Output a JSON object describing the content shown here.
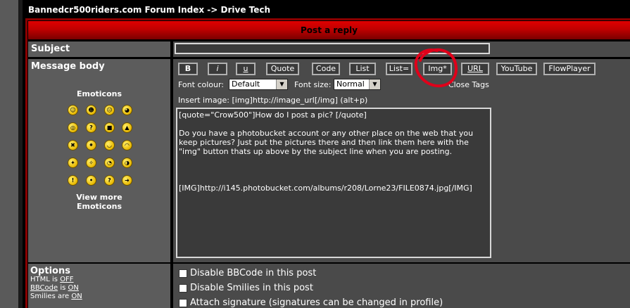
{
  "breadcrumb": "Bannedcr500riders.com Forum Index -> Drive Tech",
  "header": {
    "title": "Post a reply"
  },
  "subject": {
    "label": "Subject",
    "value": ""
  },
  "message": {
    "label": "Message body"
  },
  "toolbar": {
    "buttons": [
      "B",
      "i",
      "u",
      "Quote",
      "Code",
      "List",
      "List=",
      "Img*",
      "URL",
      "YouTube",
      "FlowPlayer"
    ],
    "font_colour_label": "Font colour:",
    "font_colour_value": "Default",
    "font_size_label": "Font size:",
    "font_size_value": "Normal",
    "close_tags": "Close Tags",
    "hint": "Insert image: [img]http://image_url[/img]  (alt+p)"
  },
  "emoticons": {
    "title": "Emoticons",
    "icons": [
      "smile-icon",
      "grin-icon",
      "sad-icon",
      "surprised-icon",
      "shocked-icon",
      "confused-icon",
      "cool-icon",
      "laughing-icon",
      "mad-icon",
      "razz-icon",
      "embarrassed-icon",
      "crying-icon",
      "evil-icon",
      "twisted-icon",
      "rolleyes-icon",
      "wink-icon",
      "exclaim-icon",
      "idea-icon",
      "question-icon",
      "arrow-icon"
    ],
    "view_more_line1": "View more",
    "view_more_line2": "Emoticons"
  },
  "body_text": {
    "line1": "[quote=\"Crow500\"]How do I post a pic? [/quote]",
    "line2": "Do you have a photobucket account or any other place on the web that you keep pictures? Just put the pictures there and then link them here with the \"img\" button thats up above by the subject line when you are posting.",
    "line3": "[IMG]http://i145.photobucket.com/albums/r208/Lorne23/FILE0874.jpg[/IMG]"
  },
  "options": {
    "title": "Options",
    "html_prefix": "HTML is",
    "html_state": "OFF",
    "bbcode_link": "BBCode",
    "bbcode_mid": "is",
    "bbcode_state": "ON",
    "smilies_prefix": "Smilies are",
    "smilies_state": "ON",
    "disable_bbcode": "Disable BBCode in this post",
    "disable_smilies": "Disable Smilies in this post",
    "attach_signature": "Attach signature (signatures can be changed in profile)"
  },
  "annotation_color": "#e0001a"
}
